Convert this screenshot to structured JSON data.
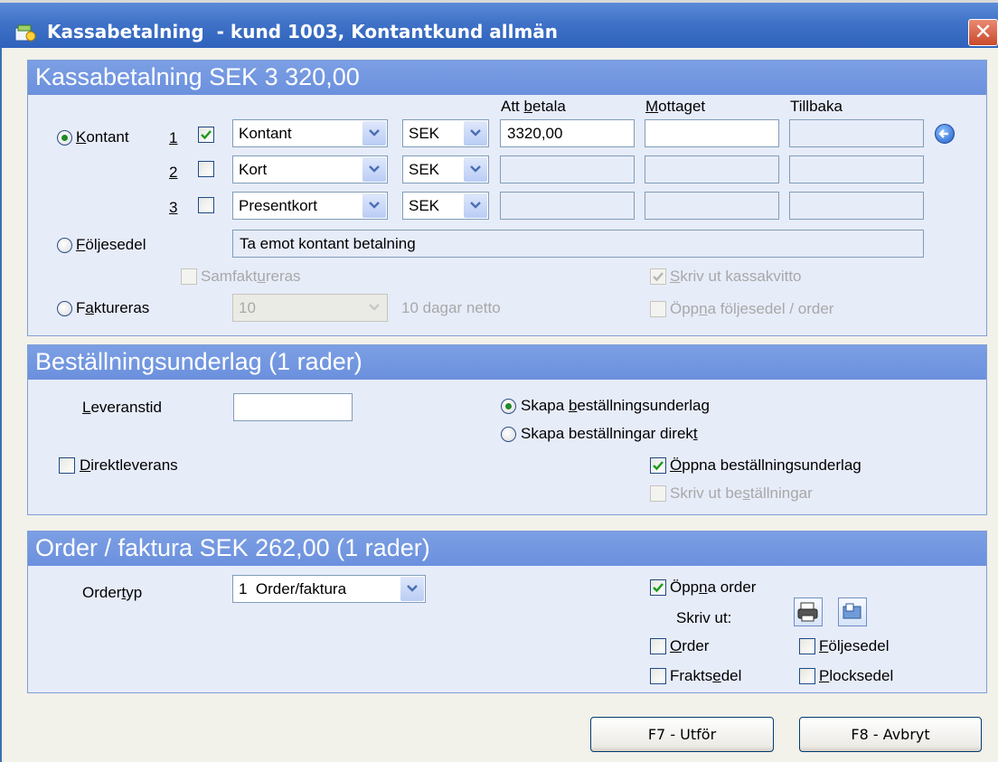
{
  "window": {
    "title": "Kassabetalning  - kund 1003, Kontantkund allmän",
    "close_glyph": "✕"
  },
  "payment": {
    "heading": "Kassabetalning SEK 3 320,00",
    "col_att_betala": "Att betala",
    "col_mottaget": "Mottaget",
    "col_tillbaka": "Tillbaka",
    "radio_kontant": "Kontant",
    "rows": [
      {
        "num": "1",
        "checked": true,
        "method": "Kontant",
        "currency": "SEK",
        "att_betala": "3320,00"
      },
      {
        "num": "2",
        "checked": false,
        "method": "Kort",
        "currency": "SEK",
        "att_betala": ""
      },
      {
        "num": "3",
        "checked": false,
        "method": "Presentkort",
        "currency": "SEK",
        "att_betala": ""
      }
    ],
    "radio_foljesedel": "Följesedel",
    "foljesedel_text": "Ta emot kontant betalning",
    "samfaktureras": "Samfaktureras",
    "skriv_ut_kassakvitto": "Skriv ut kassakvitto",
    "radio_faktureras": "Faktureras",
    "terms_value": "10",
    "terms_text": "10 dagar netto",
    "oppna_foljesedel_order": "Öppna följesedel / order"
  },
  "orderbasis": {
    "heading": "Beställningsunderlag (1 rader)",
    "leveranstid_label": "Leveranstid",
    "leveranstid_value": "",
    "radio_skapa_underlag": "Skapa beställningsunderlag",
    "radio_skapa_direkt": "Skapa beställningar direkt",
    "direktleverans": "Direktleverans",
    "oppna_underlag": "Öppna beställningsunderlag",
    "skriv_ut_bestallningar": "Skriv ut beställningar"
  },
  "order": {
    "heading": "Order / faktura SEK 262,00 (1 rader)",
    "ordertyp_label": "Ordertyp",
    "ordertyp_value": "1  Order/faktura",
    "oppna_order": "Öppna order",
    "skriv_ut": "Skriv ut:",
    "cb_order": "Order",
    "cb_foljesedel": "Följesedel",
    "cb_fraktsedel": "Fraktsedel",
    "cb_plocksedel": "Plocksedel"
  },
  "buttons": {
    "execute": "F7 - Utför",
    "cancel": "F8 - Avbryt"
  },
  "colors": {
    "titlebar": "#3f72c7",
    "panel_header": "#7c9fe4",
    "panel_bg": "#e7ecf9",
    "window_bg": "#f2f1ea"
  }
}
